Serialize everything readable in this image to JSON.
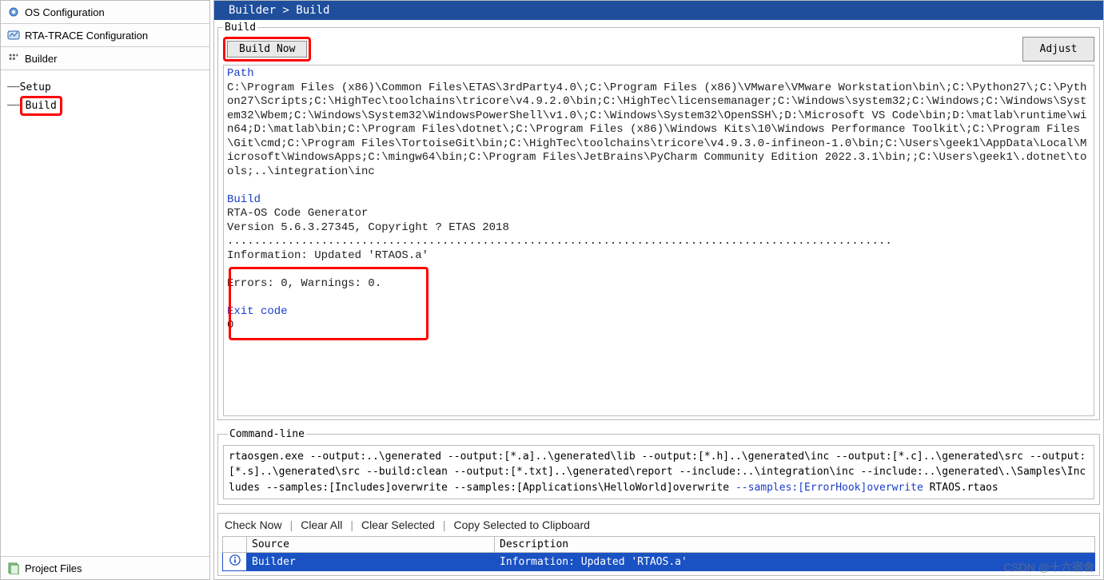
{
  "sidebar": {
    "items": [
      {
        "label": "OS Configuration",
        "icon": "gear-icon"
      },
      {
        "label": "RTA-TRACE Configuration",
        "icon": "trace-icon"
      },
      {
        "label": "Builder",
        "icon": "builder-icon"
      }
    ],
    "tree": {
      "setup_label": "Setup",
      "build_label": "Build"
    },
    "bottom": {
      "label": "Project Files",
      "icon": "files-icon"
    }
  },
  "breadcrumb": "Builder > Build",
  "build_group": {
    "legend": "Build",
    "build_now_label": "Build Now",
    "adjust_label": "Adjust"
  },
  "log": {
    "path_header": "Path",
    "path_body": "C:\\Program Files (x86)\\Common Files\\ETAS\\3rdParty4.0\\;C:\\Program Files (x86)\\VMware\\VMware Workstation\\bin\\;C:\\Python27\\;C:\\Python27\\Scripts;C:\\HighTec\\toolchains\\tricore\\v4.9.2.0\\bin;C:\\HighTec\\licensemanager;C:\\Windows\\system32;C:\\Windows;C:\\Windows\\System32\\Wbem;C:\\Windows\\System32\\WindowsPowerShell\\v1.0\\;C:\\Windows\\System32\\OpenSSH\\;D:\\Microsoft VS Code\\bin;D:\\matlab\\runtime\\win64;D:\\matlab\\bin;C:\\Program Files\\dotnet\\;C:\\Program Files (x86)\\Windows Kits\\10\\Windows Performance Toolkit\\;C:\\Program Files\\Git\\cmd;C:\\Program Files\\TortoiseGit\\bin;C:\\HighTec\\toolchains\\tricore\\v4.9.3.0-infineon-1.0\\bin;C:\\Users\\geek1\\AppData\\Local\\Microsoft\\WindowsApps;C:\\mingw64\\bin;C:\\Program Files\\JetBrains\\PyCharm Community Edition 2022.3.1\\bin;;C:\\Users\\geek1\\.dotnet\\tools;..\\integration\\inc",
    "build_header": "Build",
    "build_body": "RTA-OS Code Generator\nVersion 5.6.3.27345, Copyright ? ETAS 2018\n...................................................................................................\nInformation: Updated 'RTAOS.a'",
    "errors_line": "Errors: 0, Warnings: 0.",
    "exit_header": "Exit code",
    "exit_value": "0"
  },
  "cmd": {
    "legend": "Command-line",
    "text_plain": "rtaosgen.exe --output:..\\generated --output:[*.a]..\\generated\\lib --output:[*.h]..\\generated\\inc --output:[*.c]..\\generated\\src --output:[*.s]..\\generated\\src --build:clean --output:[*.txt]..\\generated\\report --include:..\\integration\\inc --include:..\\generated\\.\\Samples\\Includes --samples:[Includes]overwrite --samples:[Applications\\HelloWorld]overwrite ",
    "text_blue": "--samples:[ErrorHook]overwrite",
    "text_tail": " RTAOS.rtaos"
  },
  "messages": {
    "actions": {
      "check_now": "Check Now",
      "clear_all": "Clear All",
      "clear_selected": "Clear Selected",
      "copy_selected": "Copy Selected to Clipboard"
    },
    "columns": {
      "icon": "",
      "source": "Source",
      "description": "Description"
    },
    "rows": [
      {
        "icon": "info-icon",
        "source": "Builder",
        "description": "Information: Updated 'RTAOS.a'"
      }
    ]
  },
  "watermark": "CSDN @十六宿舍"
}
